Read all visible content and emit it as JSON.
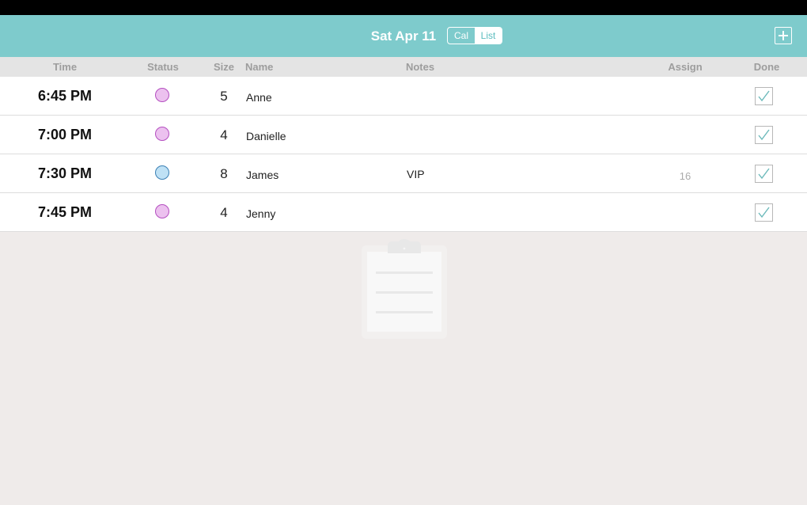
{
  "header": {
    "date": "Sat Apr 11",
    "view_toggle": {
      "cal_label": "Cal",
      "list_label": "List",
      "selected": "List"
    },
    "add_icon": "plus-icon"
  },
  "columns": {
    "time": "Time",
    "status": "Status",
    "size": "Size",
    "name": "Name",
    "notes": "Notes",
    "assign": "Assign",
    "done": "Done"
  },
  "colors": {
    "accent": "#7ecbcc",
    "status_pink": "#ecc1ef",
    "status_pink_border": "#b44fc0",
    "status_blue": "#bfe1f5",
    "status_blue_border": "#3b80b5"
  },
  "reservations": [
    {
      "time": "6:45 PM",
      "status": "pink",
      "size": "5",
      "name": "Anne",
      "notes": "",
      "assign": "",
      "done": true
    },
    {
      "time": "7:00 PM",
      "status": "pink",
      "size": "4",
      "name": "Danielle",
      "notes": "",
      "assign": "",
      "done": true
    },
    {
      "time": "7:30 PM",
      "status": "blue",
      "size": "8",
      "name": "James",
      "notes": "VIP",
      "assign": "16",
      "done": true
    },
    {
      "time": "7:45 PM",
      "status": "pink",
      "size": "4",
      "name": "Jenny",
      "notes": "",
      "assign": "",
      "done": true
    }
  ],
  "empty_state_icon": "clipboard-icon"
}
